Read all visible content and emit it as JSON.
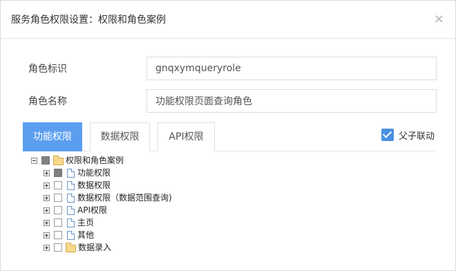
{
  "dialog": {
    "title": "服务角色权限设置：权限和角色案例",
    "close_glyph": "×"
  },
  "form": {
    "role_id_label": "角色标识",
    "role_id_value": "gnqxymqueryrole",
    "role_name_label": "角色名称",
    "role_name_value": "功能权限页面查询角色"
  },
  "tabs": [
    {
      "label": "功能权限",
      "active": true
    },
    {
      "label": "数据权限",
      "active": false
    },
    {
      "label": "API权限",
      "active": false
    }
  ],
  "linkage": {
    "label": "父子联动",
    "checked": true
  },
  "tree": {
    "root": {
      "label": "权限和角色案例",
      "expanded": true,
      "check_state": "partial",
      "icon": "folder-icon"
    },
    "children": [
      {
        "label": "功能权限",
        "check_state": "partial",
        "icon": "document-icon"
      },
      {
        "label": "数据权限",
        "check_state": "unchecked",
        "icon": "document-icon"
      },
      {
        "label": "数据权限（数据范围查询)",
        "check_state": "unchecked",
        "icon": "document-icon"
      },
      {
        "label": "API权限",
        "check_state": "unchecked",
        "icon": "document-icon"
      },
      {
        "label": "主页",
        "check_state": "unchecked",
        "icon": "document-icon"
      },
      {
        "label": "其他",
        "check_state": "unchecked",
        "icon": "document-icon"
      },
      {
        "label": "数据录入",
        "check_state": "unchecked",
        "icon": "folder-icon"
      }
    ]
  },
  "colors": {
    "accent": "#5b9ef0",
    "checkbox_checked": "#4a90e2",
    "partial_check": "#808080"
  }
}
